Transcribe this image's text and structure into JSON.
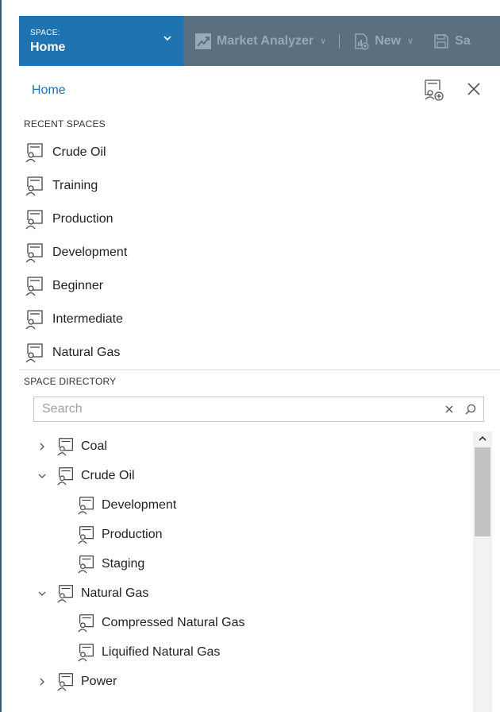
{
  "space_switcher": {
    "kicker": "SPACE:",
    "name": "Home"
  },
  "toolbar": {
    "market_analyzer_label": "Market Analyzer",
    "new_label": "New",
    "save_label": "Sa"
  },
  "panel": {
    "title": "Home"
  },
  "recent": {
    "label": "RECENT SPACES",
    "items": [
      {
        "label": "Crude Oil"
      },
      {
        "label": "Training"
      },
      {
        "label": "Production"
      },
      {
        "label": "Development"
      },
      {
        "label": "Beginner"
      },
      {
        "label": "Intermediate"
      },
      {
        "label": "Natural Gas"
      }
    ]
  },
  "directory": {
    "label": "SPACE DIRECTORY",
    "search_placeholder": "Search",
    "tree": [
      {
        "label": "Coal",
        "level": 0,
        "expanded": false
      },
      {
        "label": "Crude Oil",
        "level": 0,
        "expanded": true
      },
      {
        "label": "Development",
        "level": 1
      },
      {
        "label": "Production",
        "level": 1
      },
      {
        "label": "Staging",
        "level": 1
      },
      {
        "label": "Natural Gas",
        "level": 0,
        "expanded": true
      },
      {
        "label": "Compressed Natural Gas",
        "level": 1
      },
      {
        "label": "Liquified Natural Gas",
        "level": 1
      },
      {
        "label": "Power",
        "level": 0,
        "expanded": false
      }
    ]
  },
  "colors": {
    "accent": "#1e73b0",
    "toolbar_bg": "#5a6f7f",
    "toolbar_text": "#98a8b4"
  }
}
